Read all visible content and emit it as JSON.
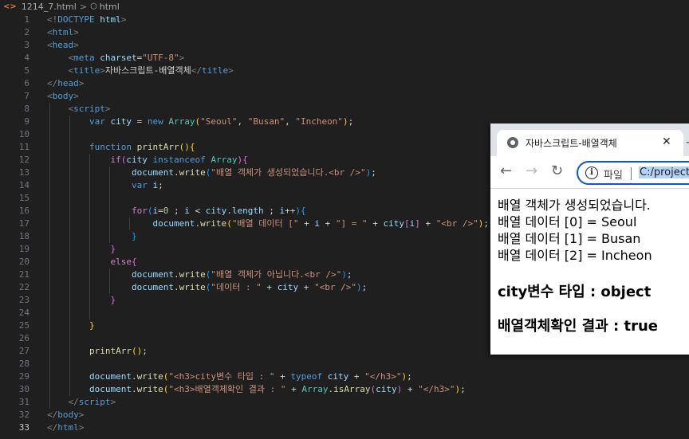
{
  "breadcrumb": {
    "file": "1214_7.html",
    "separator": ">",
    "element": "html"
  },
  "colors": {
    "editor_bg": "#1f1f1f",
    "line_number": "#6e7681",
    "tag": "#569cd6",
    "attribute": "#9cdcfe",
    "string": "#ce9178",
    "function": "#dcdcaa",
    "control_keyword": "#c586c0",
    "class": "#4ec9b0",
    "omnibox_border": "#0b57d0"
  },
  "editor": {
    "active_line": "33",
    "lines": [
      {
        "n": "1",
        "tokens": [
          {
            "t": "<!",
            "c": "t-tag"
          },
          {
            "t": "DOCTYPE",
            "c": "t-name"
          },
          {
            "t": " ",
            "c": "t-txt"
          },
          {
            "t": "html",
            "c": "t-attr"
          },
          {
            "t": ">",
            "c": "t-tag"
          }
        ]
      },
      {
        "n": "2",
        "tokens": [
          {
            "t": "<",
            "c": "t-tag"
          },
          {
            "t": "html",
            "c": "t-name"
          },
          {
            "t": ">",
            "c": "t-tag"
          }
        ]
      },
      {
        "n": "3",
        "tokens": [
          {
            "t": "<",
            "c": "t-tag"
          },
          {
            "t": "head",
            "c": "t-name"
          },
          {
            "t": ">",
            "c": "t-tag"
          }
        ]
      },
      {
        "n": "4",
        "tokens": [
          {
            "t": "    ",
            "c": "t-txt"
          },
          {
            "t": "<",
            "c": "t-tag"
          },
          {
            "t": "meta",
            "c": "t-name"
          },
          {
            "t": " ",
            "c": "t-txt"
          },
          {
            "t": "charset",
            "c": "t-attr"
          },
          {
            "t": "=",
            "c": "t-txt"
          },
          {
            "t": "\"UTF-8\"",
            "c": "t-str"
          },
          {
            "t": ">",
            "c": "t-tag"
          }
        ]
      },
      {
        "n": "5",
        "tokens": [
          {
            "t": "    ",
            "c": "t-txt"
          },
          {
            "t": "<",
            "c": "t-tag"
          },
          {
            "t": "title",
            "c": "t-name"
          },
          {
            "t": ">",
            "c": "t-tag"
          },
          {
            "t": "자바스크립트-배열객체",
            "c": "t-txt"
          },
          {
            "t": "</",
            "c": "t-tag"
          },
          {
            "t": "title",
            "c": "t-name"
          },
          {
            "t": ">",
            "c": "t-tag"
          }
        ]
      },
      {
        "n": "6",
        "tokens": [
          {
            "t": "</",
            "c": "t-tag"
          },
          {
            "t": "head",
            "c": "t-name"
          },
          {
            "t": ">",
            "c": "t-tag"
          }
        ]
      },
      {
        "n": "7",
        "tokens": [
          {
            "t": "<",
            "c": "t-tag"
          },
          {
            "t": "body",
            "c": "t-name"
          },
          {
            "t": ">",
            "c": "t-tag"
          }
        ]
      },
      {
        "n": "8",
        "tokens": [
          {
            "t": "    ",
            "c": "t-txt"
          },
          {
            "t": "<",
            "c": "t-tag"
          },
          {
            "t": "script",
            "c": "t-name"
          },
          {
            "t": ">",
            "c": "t-tag"
          }
        ]
      },
      {
        "n": "9",
        "tokens": [
          {
            "t": "        ",
            "c": "t-txt"
          },
          {
            "t": "var",
            "c": "t-kw"
          },
          {
            "t": " ",
            "c": "t-txt"
          },
          {
            "t": "city",
            "c": "t-var"
          },
          {
            "t": " = ",
            "c": "t-txt"
          },
          {
            "t": "new",
            "c": "t-kw"
          },
          {
            "t": " ",
            "c": "t-txt"
          },
          {
            "t": "Array",
            "c": "t-cls"
          },
          {
            "t": "(",
            "c": "t-b1"
          },
          {
            "t": "\"Seoul\"",
            "c": "t-str"
          },
          {
            "t": ", ",
            "c": "t-txt"
          },
          {
            "t": "\"Busan\"",
            "c": "t-str"
          },
          {
            "t": ", ",
            "c": "t-txt"
          },
          {
            "t": "\"Incheon\"",
            "c": "t-str"
          },
          {
            "t": ")",
            "c": "t-b1"
          },
          {
            "t": ";",
            "c": "t-txt"
          }
        ]
      },
      {
        "n": "10",
        "tokens": []
      },
      {
        "n": "11",
        "tokens": [
          {
            "t": "        ",
            "c": "t-txt"
          },
          {
            "t": "function",
            "c": "t-kw"
          },
          {
            "t": " ",
            "c": "t-txt"
          },
          {
            "t": "printArr",
            "c": "t-fn"
          },
          {
            "t": "()",
            "c": "t-b1"
          },
          {
            "t": "{",
            "c": "t-b1"
          }
        ]
      },
      {
        "n": "12",
        "tokens": [
          {
            "t": "            ",
            "c": "t-txt"
          },
          {
            "t": "if",
            "c": "t-ctrl"
          },
          {
            "t": "(",
            "c": "t-b2"
          },
          {
            "t": "city",
            "c": "t-var"
          },
          {
            "t": " ",
            "c": "t-txt"
          },
          {
            "t": "instanceof",
            "c": "t-kw"
          },
          {
            "t": " ",
            "c": "t-txt"
          },
          {
            "t": "Array",
            "c": "t-cls"
          },
          {
            "t": ")",
            "c": "t-b2"
          },
          {
            "t": "{",
            "c": "t-b2"
          }
        ]
      },
      {
        "n": "13",
        "tokens": [
          {
            "t": "                ",
            "c": "t-txt"
          },
          {
            "t": "document",
            "c": "t-var"
          },
          {
            "t": ".",
            "c": "t-txt"
          },
          {
            "t": "write",
            "c": "t-fn"
          },
          {
            "t": "(",
            "c": "t-b3"
          },
          {
            "t": "\"배열 객체가 생성되었습니다.<br />\"",
            "c": "t-str"
          },
          {
            "t": ")",
            "c": "t-b3"
          },
          {
            "t": ";",
            "c": "t-txt"
          }
        ]
      },
      {
        "n": "14",
        "tokens": [
          {
            "t": "                ",
            "c": "t-txt"
          },
          {
            "t": "var",
            "c": "t-kw"
          },
          {
            "t": " ",
            "c": "t-txt"
          },
          {
            "t": "i",
            "c": "t-var"
          },
          {
            "t": ";",
            "c": "t-txt"
          }
        ]
      },
      {
        "n": "15",
        "tokens": []
      },
      {
        "n": "16",
        "tokens": [
          {
            "t": "                ",
            "c": "t-txt"
          },
          {
            "t": "for",
            "c": "t-ctrl"
          },
          {
            "t": "(",
            "c": "t-b3"
          },
          {
            "t": "i",
            "c": "t-var"
          },
          {
            "t": "=",
            "c": "t-txt"
          },
          {
            "t": "0",
            "c": "t-num"
          },
          {
            "t": " ; ",
            "c": "t-txt"
          },
          {
            "t": "i",
            "c": "t-var"
          },
          {
            "t": " < ",
            "c": "t-txt"
          },
          {
            "t": "city",
            "c": "t-var"
          },
          {
            "t": ".",
            "c": "t-txt"
          },
          {
            "t": "length",
            "c": "t-var"
          },
          {
            "t": " ; ",
            "c": "t-txt"
          },
          {
            "t": "i",
            "c": "t-var"
          },
          {
            "t": "++",
            "c": "t-txt"
          },
          {
            "t": ")",
            "c": "t-b3"
          },
          {
            "t": "{",
            "c": "t-b3"
          }
        ]
      },
      {
        "n": "17",
        "tokens": [
          {
            "t": "                    ",
            "c": "t-txt"
          },
          {
            "t": "document",
            "c": "t-var"
          },
          {
            "t": ".",
            "c": "t-txt"
          },
          {
            "t": "write",
            "c": "t-fn"
          },
          {
            "t": "(",
            "c": "t-b1"
          },
          {
            "t": "\"배열 데이터 [\"",
            "c": "t-str"
          },
          {
            "t": " + ",
            "c": "t-txt"
          },
          {
            "t": "i",
            "c": "t-var"
          },
          {
            "t": " + ",
            "c": "t-txt"
          },
          {
            "t": "\"] = \"",
            "c": "t-str"
          },
          {
            "t": " + ",
            "c": "t-txt"
          },
          {
            "t": "city",
            "c": "t-var"
          },
          {
            "t": "[",
            "c": "t-b2"
          },
          {
            "t": "i",
            "c": "t-var"
          },
          {
            "t": "]",
            "c": "t-b2"
          },
          {
            "t": " + ",
            "c": "t-txt"
          },
          {
            "t": "\"<br />\"",
            "c": "t-str"
          },
          {
            "t": ")",
            "c": "t-b1"
          },
          {
            "t": ";",
            "c": "t-txt"
          }
        ]
      },
      {
        "n": "18",
        "tokens": [
          {
            "t": "                ",
            "c": "t-txt"
          },
          {
            "t": "}",
            "c": "t-b3"
          }
        ]
      },
      {
        "n": "19",
        "tokens": [
          {
            "t": "            ",
            "c": "t-txt"
          },
          {
            "t": "}",
            "c": "t-b2"
          }
        ]
      },
      {
        "n": "20",
        "tokens": [
          {
            "t": "            ",
            "c": "t-txt"
          },
          {
            "t": "else",
            "c": "t-ctrl"
          },
          {
            "t": "{",
            "c": "t-b2"
          }
        ]
      },
      {
        "n": "21",
        "tokens": [
          {
            "t": "                ",
            "c": "t-txt"
          },
          {
            "t": "document",
            "c": "t-var"
          },
          {
            "t": ".",
            "c": "t-txt"
          },
          {
            "t": "write",
            "c": "t-fn"
          },
          {
            "t": "(",
            "c": "t-b3"
          },
          {
            "t": "\"배열 객체가 아닙니다.<br />\"",
            "c": "t-str"
          },
          {
            "t": ")",
            "c": "t-b3"
          },
          {
            "t": ";",
            "c": "t-txt"
          }
        ]
      },
      {
        "n": "22",
        "tokens": [
          {
            "t": "                ",
            "c": "t-txt"
          },
          {
            "t": "document",
            "c": "t-var"
          },
          {
            "t": ".",
            "c": "t-txt"
          },
          {
            "t": "write",
            "c": "t-fn"
          },
          {
            "t": "(",
            "c": "t-b3"
          },
          {
            "t": "\"데이터 : \"",
            "c": "t-str"
          },
          {
            "t": " + ",
            "c": "t-txt"
          },
          {
            "t": "city",
            "c": "t-var"
          },
          {
            "t": " + ",
            "c": "t-txt"
          },
          {
            "t": "\"<br />\"",
            "c": "t-str"
          },
          {
            "t": ")",
            "c": "t-b3"
          },
          {
            "t": ";",
            "c": "t-txt"
          }
        ]
      },
      {
        "n": "23",
        "tokens": [
          {
            "t": "            ",
            "c": "t-txt"
          },
          {
            "t": "}",
            "c": "t-b2"
          }
        ]
      },
      {
        "n": "24",
        "tokens": []
      },
      {
        "n": "25",
        "tokens": [
          {
            "t": "        ",
            "c": "t-txt"
          },
          {
            "t": "}",
            "c": "t-b1"
          }
        ]
      },
      {
        "n": "26",
        "tokens": []
      },
      {
        "n": "27",
        "tokens": [
          {
            "t": "        ",
            "c": "t-txt"
          },
          {
            "t": "printArr",
            "c": "t-fn"
          },
          {
            "t": "()",
            "c": "t-b1"
          },
          {
            "t": ";",
            "c": "t-txt"
          }
        ]
      },
      {
        "n": "28",
        "tokens": []
      },
      {
        "n": "29",
        "tokens": [
          {
            "t": "        ",
            "c": "t-txt"
          },
          {
            "t": "document",
            "c": "t-var"
          },
          {
            "t": ".",
            "c": "t-txt"
          },
          {
            "t": "write",
            "c": "t-fn"
          },
          {
            "t": "(",
            "c": "t-b1"
          },
          {
            "t": "\"<h3>city변수 타입 : \"",
            "c": "t-str"
          },
          {
            "t": " + ",
            "c": "t-txt"
          },
          {
            "t": "typeof",
            "c": "t-kw"
          },
          {
            "t": " ",
            "c": "t-txt"
          },
          {
            "t": "city",
            "c": "t-var"
          },
          {
            "t": " + ",
            "c": "t-txt"
          },
          {
            "t": "\"</h3>\"",
            "c": "t-str"
          },
          {
            "t": ")",
            "c": "t-b1"
          },
          {
            "t": ";",
            "c": "t-txt"
          }
        ]
      },
      {
        "n": "30",
        "tokens": [
          {
            "t": "        ",
            "c": "t-txt"
          },
          {
            "t": "document",
            "c": "t-var"
          },
          {
            "t": ".",
            "c": "t-txt"
          },
          {
            "t": "write",
            "c": "t-fn"
          },
          {
            "t": "(",
            "c": "t-b1"
          },
          {
            "t": "\"<h3>배열객체확인 결과 : \"",
            "c": "t-str"
          },
          {
            "t": " + ",
            "c": "t-txt"
          },
          {
            "t": "Array",
            "c": "t-cls"
          },
          {
            "t": ".",
            "c": "t-txt"
          },
          {
            "t": "isArray",
            "c": "t-fn"
          },
          {
            "t": "(",
            "c": "t-b2"
          },
          {
            "t": "city",
            "c": "t-var"
          },
          {
            "t": ")",
            "c": "t-b2"
          },
          {
            "t": " + ",
            "c": "t-txt"
          },
          {
            "t": "\"</h3>\"",
            "c": "t-str"
          },
          {
            "t": ")",
            "c": "t-b1"
          },
          {
            "t": ";",
            "c": "t-txt"
          }
        ]
      },
      {
        "n": "31",
        "tokens": [
          {
            "t": "    ",
            "c": "t-txt"
          },
          {
            "t": "</",
            "c": "t-tag"
          },
          {
            "t": "script",
            "c": "t-name"
          },
          {
            "t": ">",
            "c": "t-tag"
          }
        ]
      },
      {
        "n": "32",
        "tokens": [
          {
            "t": "</",
            "c": "t-tag"
          },
          {
            "t": "body",
            "c": "t-name"
          },
          {
            "t": ">",
            "c": "t-tag"
          }
        ]
      },
      {
        "n": "33",
        "tokens": [
          {
            "t": "</",
            "c": "t-tag"
          },
          {
            "t": "html",
            "c": "t-name"
          },
          {
            "t": ">",
            "c": "t-tag"
          }
        ]
      }
    ]
  },
  "browser": {
    "tab_title": "자바스크립트-배열객체",
    "tab_close": "✕",
    "new_tab": "+",
    "back_icon": "arrow-left-icon",
    "forward_icon": "arrow-right-icon",
    "reload_icon": "reload-icon",
    "omnibox_label": "파일",
    "omnibox_url": "C:/project",
    "content": {
      "lines": [
        "배열 객체가 생성되었습니다.",
        "배열 데이터 [0] = Seoul",
        "배열 데이터 [1] = Busan",
        "배열 데이터 [2] = Incheon"
      ],
      "h3_type": "city변수 타입 : object",
      "h3_isarray": "배열객체확인 결과 : true"
    }
  }
}
